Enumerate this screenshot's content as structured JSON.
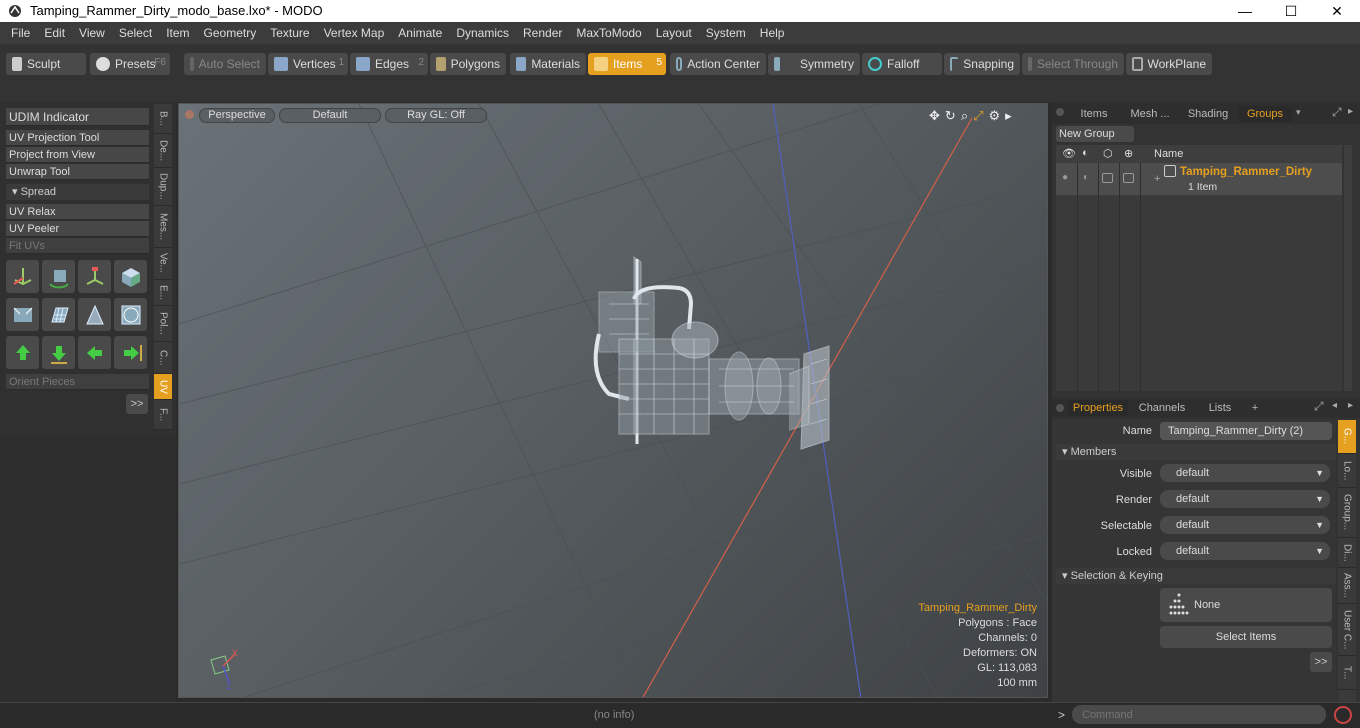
{
  "window": {
    "title": "Tamping_Rammer_Dirty_modo_base.lxo* - MODO",
    "minimize": "—",
    "maximize": "☐",
    "close": "✕"
  },
  "menu": [
    "File",
    "Edit",
    "View",
    "Select",
    "Item",
    "Geometry",
    "Texture",
    "Vertex Map",
    "Animate",
    "Dynamics",
    "Render",
    "MaxToModo",
    "Layout",
    "System",
    "Help"
  ],
  "toolbar": {
    "sculpt": "Sculpt",
    "presets": "Presets",
    "presets_key": "F6",
    "auto_select": "Auto Select",
    "vertices": "Vertices",
    "vertices_num": "1",
    "edges": "Edges",
    "edges_num": "2",
    "polygons": "Polygons",
    "materials": "Materials",
    "items": "Items",
    "items_num": "5",
    "action_center": "Action Center",
    "symmetry": "Symmetry",
    "falloff": "Falloff",
    "snapping": "Snapping",
    "select_through": "Select Through",
    "workplane": "WorkPlane"
  },
  "left_tools": {
    "udim": "UDIM Indicator",
    "uv_projection": "UV Projection Tool",
    "project_view": "Project from View",
    "unwrap": "Unwrap Tool",
    "spread": "Spread",
    "uv_relax": "UV Relax",
    "uv_peeler": "UV Peeler",
    "fit_uvs": "Fit UVs",
    "orient": "Orient Pieces",
    "more": ">>"
  },
  "side_tabs": [
    "B...",
    "De...",
    "Dup...",
    "Mes...",
    "Ve...",
    "E...",
    "Pol...",
    "C...",
    "UV",
    "F..."
  ],
  "viewport": {
    "perspective": "Perspective",
    "default": "Default",
    "raygl": "Ray GL: Off",
    "info_name": "Tamping_Rammer_Dirty",
    "info_polys": "Polygons : Face",
    "info_channels": "Channels: 0",
    "info_deformers": "Deformers: ON",
    "info_gl": "GL: 113,083",
    "info_scale": "100 mm"
  },
  "groups_panel": {
    "tabs": [
      "Items",
      "Mesh ...",
      "Shading",
      "Groups"
    ],
    "new_group": "New Group",
    "name_col": "Name",
    "item_name": "Tamping_Rammer_Dirty",
    "item_count": "1 Item"
  },
  "properties_panel": {
    "tabs": [
      "Properties",
      "Channels",
      "Lists"
    ],
    "add": "+",
    "name_label": "Name",
    "name_value": "Tamping_Rammer_Dirty (2)",
    "members": "Members",
    "visible_label": "Visible",
    "visible_value": "default",
    "render_label": "Render",
    "render_value": "default",
    "selectable_label": "Selectable",
    "selectable_value": "default",
    "locked_label": "Locked",
    "locked_value": "default",
    "sel_keying": "Selection & Keying",
    "none": "None",
    "select_items": "Select Items",
    "more": ">>",
    "side_tabs": [
      "G...",
      "Lo...",
      "Group...",
      "Di...",
      "Ass...",
      "User C...",
      "T..."
    ]
  },
  "status": {
    "info": "(no info)",
    "command_placeholder": "Command",
    "prompt": ">"
  }
}
